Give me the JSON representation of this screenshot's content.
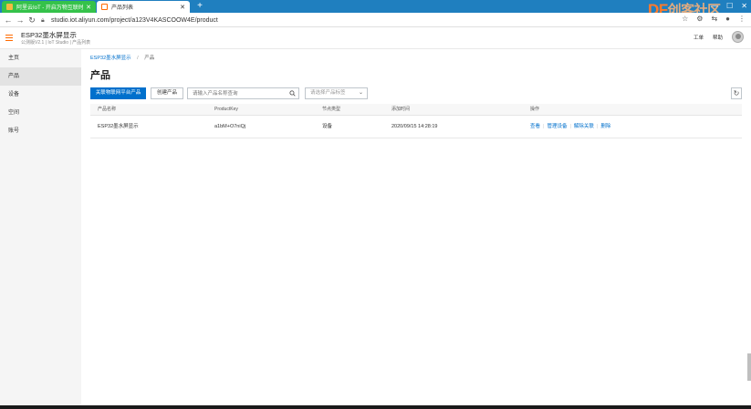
{
  "browser": {
    "tabs": [
      {
        "title": "阿里云IoT - 开启万物互联时代",
        "active": false
      },
      {
        "title": "产品列表",
        "active": true
      }
    ],
    "url": "studio.iot.aliyun.com/project/a123V4KASCOOW4E/product",
    "watermark_df": "DF",
    "watermark_cn": "创客社区"
  },
  "header": {
    "title": "ESP32墨水屏显示",
    "subtitle": "公测版V2.1 | IoT Studio | 产品列表",
    "links": [
      "工单",
      "帮助"
    ]
  },
  "sidebar": {
    "items": [
      {
        "label": "主页",
        "active": false
      },
      {
        "label": "产品",
        "active": true
      },
      {
        "label": "设备",
        "active": false
      },
      {
        "label": "空间",
        "active": false
      },
      {
        "label": "账号",
        "active": false
      }
    ]
  },
  "main": {
    "breadcrumb": {
      "root": "ESP32墨水屏显示",
      "separator": "/",
      "current": "产品"
    },
    "title": "产品",
    "toolbar": {
      "primary_label": "关联物联网平台产品",
      "create_label": "创建产品",
      "search_placeholder": "请输入产品名称查询",
      "select_placeholder": "请选择产品标签"
    },
    "table": {
      "columns": [
        "产品名称",
        "ProductKey",
        "节点类型",
        "添加时间",
        "操作"
      ],
      "rows": [
        {
          "name": "ESP32墨水屏显示",
          "product_key": "a1bM+O7niQj",
          "node_type": "设备",
          "added_time": "2020/09/15 14:28:19",
          "actions": [
            "查看",
            "管理设备",
            "解除关联",
            "删除"
          ]
        }
      ]
    }
  },
  "colors": {
    "accent": "#0070cc",
    "brand": "#ff6a00",
    "tab_strip": "#1f7fbf"
  }
}
